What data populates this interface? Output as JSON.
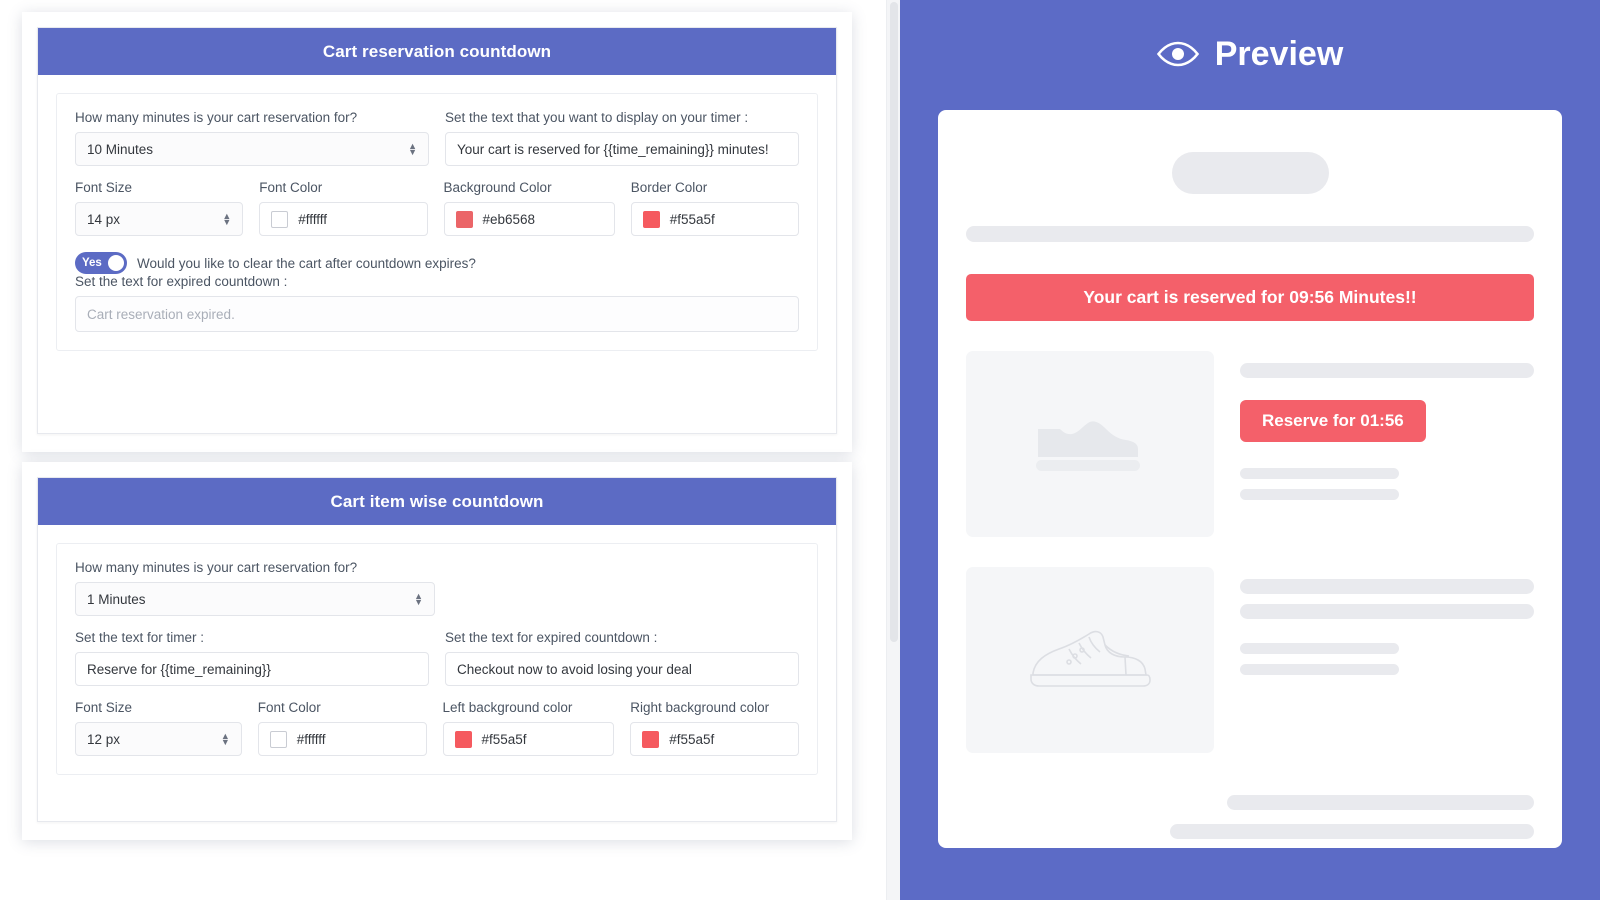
{
  "settings": {
    "cards": [
      {
        "title": "Cart reservation countdown",
        "minutes_label": "How many minutes is your cart reservation for?",
        "minutes_value": "10 Minutes",
        "timer_text_label": "Set the text that you want to display on your timer :",
        "timer_text_value": "Your cart is reserved for {{time_remaining}} minutes!",
        "font_size_label": "Font Size",
        "font_size_value": "14 px",
        "font_color_label": "Font Color",
        "font_color_value": "#ffffff",
        "background_color_label": "Background Color",
        "background_color_value": "#eb6568",
        "border_color_label": "Border Color",
        "border_color_value": "#f55a5f",
        "toggle_state": "Yes",
        "toggle_question": "Would you like to clear the cart after countdown expires?",
        "expired_label": "Set the text for expired countdown :",
        "expired_placeholder": "Cart reservation expired."
      },
      {
        "title": "Cart item wise countdown",
        "minutes_label": "How many minutes is your cart reservation for?",
        "minutes_value": "1 Minutes",
        "timer_text_label": "Set the text for timer :",
        "timer_text_value": "Reserve for {{time_remaining}}",
        "expired_label": "Set the text for expired countdown :",
        "expired_value": "Checkout now to avoid losing your deal",
        "font_size_label": "Font Size",
        "font_size_value": "12 px",
        "font_color_label": "Font Color",
        "font_color_value": "#ffffff",
        "left_bg_label": "Left background color",
        "left_bg_value": "#f55a5f",
        "right_bg_label": "Right background color",
        "right_bg_value": "#f55a5f"
      }
    ]
  },
  "preview": {
    "title": "Preview",
    "eye_icon": "eye-icon",
    "cart_banner_text": "Your cart is reserved for 09:56 Minutes!!",
    "reserve_button_text": "Reserve for 01:56",
    "product_one_icon": "shoe-solid-icon",
    "product_two_icon": "sneaker-outline-icon"
  },
  "colors": {
    "brand_purple": "#5c6bc4",
    "accent_red": "#f4606a",
    "skeleton_grey": "#e9eaee"
  }
}
